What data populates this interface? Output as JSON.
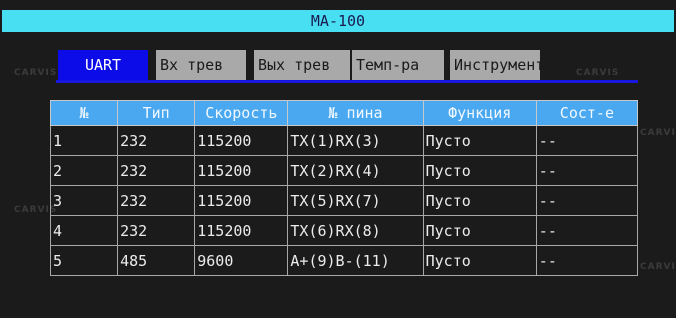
{
  "window": {
    "title": "MA-100"
  },
  "tabs": [
    {
      "label": "UART",
      "active": true
    },
    {
      "label": "Вх трев",
      "active": false
    },
    {
      "label": "Вых трев",
      "active": false
    },
    {
      "label": "Темп-ра",
      "active": false
    },
    {
      "label": "Инструменты",
      "active": false
    }
  ],
  "table": {
    "headers": [
      "№",
      "Тип",
      "Скорость",
      "№ пина",
      "Функция",
      "Сост-е"
    ],
    "rows": [
      [
        "1",
        "232",
        "115200",
        "TX(1)RX(3)",
        "Пусто",
        "--"
      ],
      [
        "2",
        "232",
        "115200",
        "TX(2)RX(4)",
        "Пусто",
        "--"
      ],
      [
        "3",
        "232",
        "115200",
        "TX(5)RX(7)",
        "Пусто",
        "--"
      ],
      [
        "4",
        "232",
        "115200",
        "TX(6)RX(8)",
        "Пусто",
        "--"
      ],
      [
        "5",
        "485",
        "9600",
        "A+(9)B-(11)",
        "Пусто",
        "--"
      ]
    ]
  },
  "watermark": "CARVIS",
  "colors": {
    "title_bar": "#49dff2",
    "active_tab": "#0c0ce8",
    "inactive_tab": "#a9a9a9",
    "table_header": "#49a8f0",
    "background": "#1b1b1b"
  }
}
